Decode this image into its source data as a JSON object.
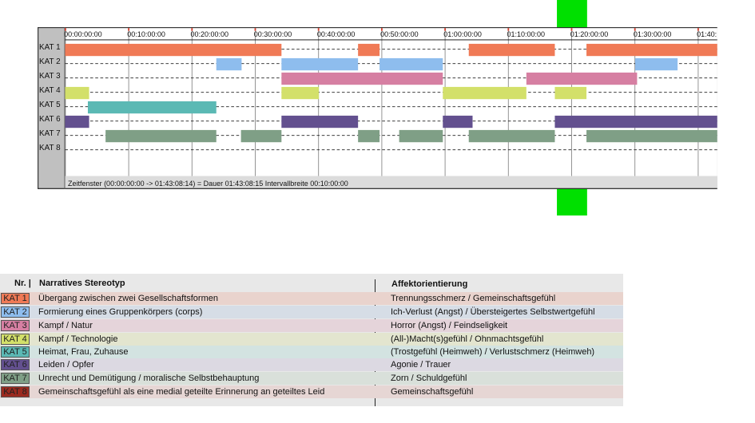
{
  "chart_data": {
    "type": "timeline",
    "categories": [
      "KAT 1",
      "KAT 2",
      "KAT 3",
      "KAT 4",
      "KAT 5",
      "KAT 6",
      "KAT 7",
      "KAT 8"
    ],
    "tick_labels": [
      "00:00:00:00",
      "00:10:00:00",
      "00:20:00:00",
      "00:30:00:00",
      "00:40:00:00",
      "00:50:00:00",
      "01:00:00:00",
      "01:10:00:00",
      "01:20:00:00",
      "01:30:00:00",
      "01:40:"
    ],
    "x_range_minutes": [
      0,
      103.14
    ],
    "tick_interval_minutes": 10,
    "series": [
      {
        "category": "KAT 1",
        "color": "#f07a56",
        "intervals": [
          [
            0,
            34.2
          ],
          [
            46.3,
            49.7
          ],
          [
            63.8,
            77.4
          ],
          [
            82.4,
            103.14
          ]
        ]
      },
      {
        "category": "KAT 2",
        "color": "#8ebdee",
        "intervals": [
          [
            23.9,
            27.9
          ],
          [
            34.2,
            46.3
          ],
          [
            49.7,
            59.7
          ],
          [
            90.1,
            96.8
          ]
        ]
      },
      {
        "category": "KAT 3",
        "color": "#d67fa2",
        "intervals": [
          [
            34.2,
            59.7
          ],
          [
            72.9,
            90.4
          ]
        ]
      },
      {
        "category": "KAT 4",
        "color": "#d3e06a",
        "intervals": [
          [
            0,
            3.8
          ],
          [
            34.2,
            40.1
          ],
          [
            59.7,
            72.9
          ],
          [
            77.4,
            82.4
          ]
        ]
      },
      {
        "category": "KAT 5",
        "color": "#5bb9b4",
        "intervals": [
          [
            3.6,
            23.9
          ]
        ]
      },
      {
        "category": "KAT 6",
        "color": "#63508f",
        "intervals": [
          [
            0,
            3.8
          ],
          [
            34.2,
            46.3
          ],
          [
            59.7,
            64.4
          ],
          [
            77.4,
            103.14
          ]
        ]
      },
      {
        "category": "KAT 7",
        "color": "#7f9f86",
        "intervals": [
          [
            6.4,
            23.9
          ],
          [
            27.8,
            34.2
          ],
          [
            46.3,
            49.7
          ],
          [
            52.8,
            59.7
          ],
          [
            63.8,
            77.4
          ],
          [
            82.4,
            103.14
          ]
        ]
      },
      {
        "category": "KAT 8",
        "color": "#9b2a1f",
        "intervals": []
      }
    ]
  },
  "timeline": {
    "status_text": "Zeitfenster (00:00:00:00 -> 01:43:08:14) = Dauer 01:43:08:15    Intervallbreite 00:10:00:00",
    "cursor_minutes": 80,
    "cursor_color": "#00e000"
  },
  "legend": {
    "headers": {
      "nr": "Nr. |",
      "stereotype": "Narratives Stereotyp",
      "affect": "Affektorientierung"
    },
    "rows": [
      {
        "badge": "KAT 1",
        "color": "#f07a56",
        "bg": "#e9d3cd",
        "stereotype": "Übergang zwischen zwei Gesellschaftsformen",
        "affect": "Trennungsschmerz / Gemeinschaftsgefühl"
      },
      {
        "badge": "KAT 2",
        "color": "#8ebdee",
        "bg": "#d6dde6",
        "stereotype": "Formierung eines Gruppenkörpers (corps)",
        "affect": "Ich-Verlust (Angst) / Übersteigertes Selbstwertgefühl"
      },
      {
        "badge": "KAT 3",
        "color": "#d67fa2",
        "bg": "#e5d4da",
        "stereotype": "Kampf / Natur",
        "affect": "Horror (Angst) / Feindseligkeit"
      },
      {
        "badge": "KAT 4",
        "color": "#d3e06a",
        "bg": "#e3e5cf",
        "stereotype": "Kampf / Technologie",
        "affect": "(All-)Macht(s)gefühl / Ohnmachtsgefühl"
      },
      {
        "badge": "KAT 5",
        "color": "#5bb9b4",
        "bg": "#d3e3e1",
        "stereotype": "Heimat, Frau, Zuhause",
        "affect": "(Trostgefühl (Heimweh) / Verlustschmerz (Heimweh)"
      },
      {
        "badge": "KAT 6",
        "color": "#63508f",
        "bg": "#dcd9e2",
        "stereotype": "Leiden / Opfer",
        "affect": "Agonie / Trauer"
      },
      {
        "badge": "KAT 7",
        "color": "#7f9f86",
        "bg": "#d9e0da",
        "stereotype": "Unrecht und Demütigung / moralische Selbstbehauptung",
        "affect": "Zorn / Schuldgefühl"
      },
      {
        "badge": "KAT 8",
        "color": "#9b2a1f",
        "bg": "#e6d6d4",
        "stereotype": "Gemeinschaftsgefühl als eine medial geteilte Erinnerung an geteiltes Leid",
        "affect": "Gemeinschaftsgefühl"
      }
    ]
  }
}
